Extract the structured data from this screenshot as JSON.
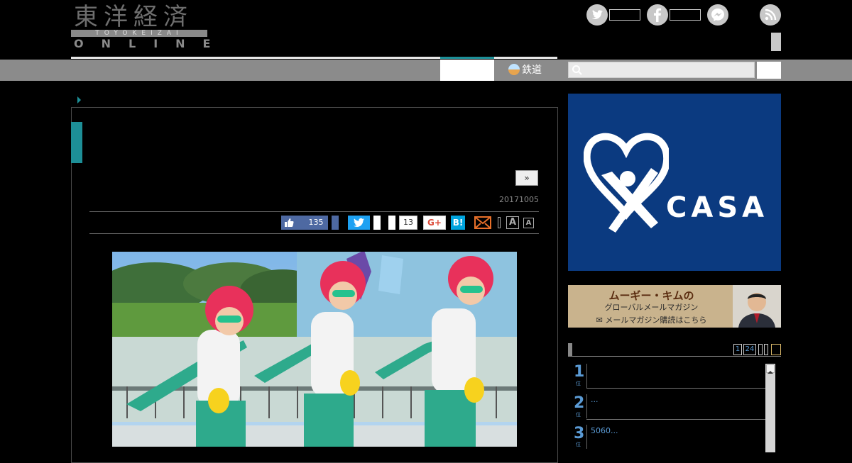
{
  "logo": {
    "title": "東洋経済",
    "subtitle": "TOYOKEIZAI",
    "online": "ONLINE"
  },
  "header": {
    "social": [
      "twitter-icon",
      "facebook-icon",
      "messenger-icon",
      "rss-icon"
    ]
  },
  "nav": {
    "rail_label": "鉄道",
    "search_placeholder": ""
  },
  "article": {
    "next_label": "»",
    "date": "20171005",
    "share": {
      "facebook_count": "135",
      "pocket_count": "13",
      "gplus_label": "G+",
      "hatena_label": "B!",
      "font_large": "A",
      "font_small": "A"
    }
  },
  "sidebar": {
    "ad1_text": "CASA",
    "ad2": {
      "line1": "ムーギー・キムの",
      "line2": "グローバルメールマガジン",
      "line3": "✉ メールマガジン購読はこちら"
    },
    "ranking": {
      "tabs": [
        "1",
        "24"
      ],
      "items": [
        {
          "rank": "1",
          "text": ""
        },
        {
          "rank": "2",
          "text": "..."
        },
        {
          "rank": "3",
          "text": "5060..."
        }
      ]
    }
  },
  "colors": {
    "teal": "#1d8f97",
    "facebook": "#4e69a2",
    "twitter": "#1da1f2",
    "casa_bg": "#0b3a80"
  }
}
